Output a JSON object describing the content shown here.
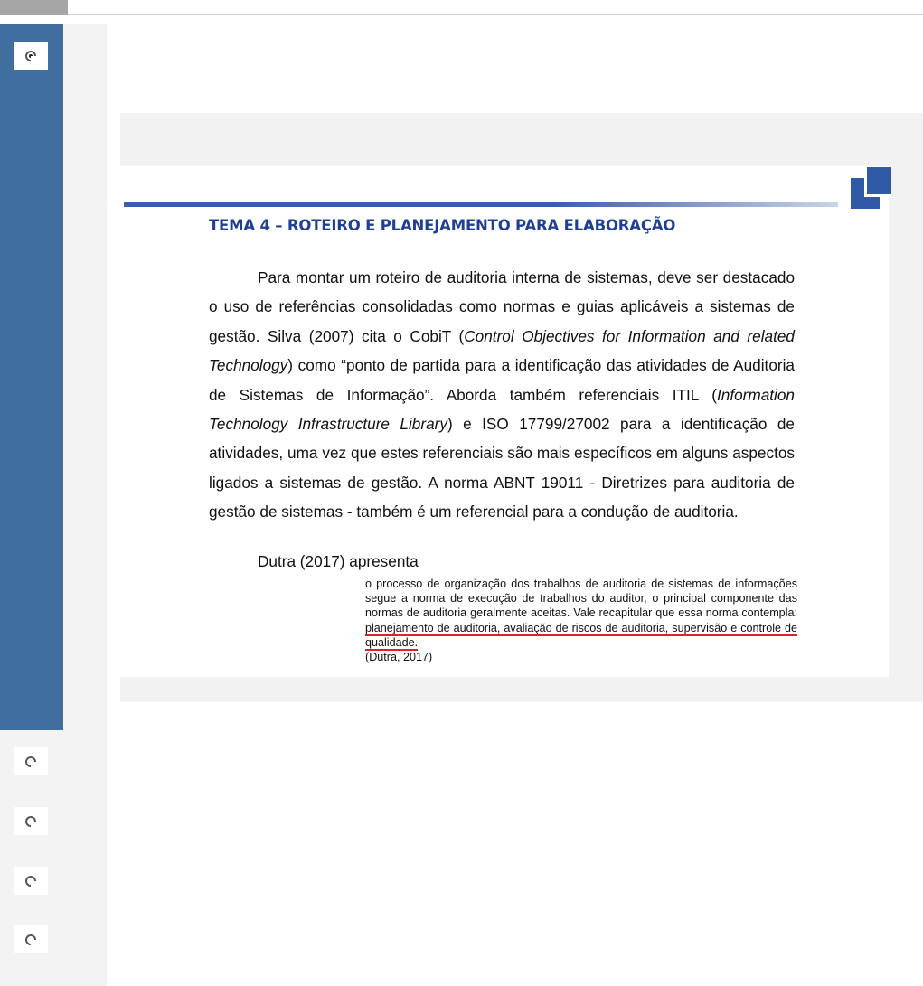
{
  "options": [
    {
      "selected": true
    },
    {
      "selected": false
    },
    {
      "selected": false
    },
    {
      "selected": false
    },
    {
      "selected": false
    }
  ],
  "slide": {
    "title": "TEMA 4 – ROTEIRO E PLANEJAMENTO PARA ELABORAÇÃO",
    "paragraph": {
      "t1": "Para montar um roteiro de auditoria interna de sistemas, deve ser destacado o uso de referências consolidadas como normas e guias aplicáveis a sistemas de gestão. Silva (2007) cita o CobiT (",
      "i1": "Control Objectives for Information and related Technology",
      "t2": ") como “ponto de partida para a identificação das atividades de Auditoria de Sistemas de Informação”. Aborda também referenciais ITIL (",
      "i2": "Information Technology Infrastructure Library",
      "t3": ") e ISO 17799/27002 para a identificação de atividades, uma vez que estes referenciais são mais específicos em alguns aspectos ligados a sistemas de gestão. A norma ABNT 19011 - Diretrizes para auditoria de gestão de sistemas - também é um referencial para a condução de auditoria."
    },
    "dutra_intro": "Dutra (2017) apresenta",
    "quote": {
      "text": "o processo de organização dos trabalhos de auditoria de sistemas de informações segue a norma de execução de trabalhos do auditor, o principal componente das normas de auditoria geralmente aceitas. Vale recapitular que essa norma contempla: ",
      "underlined": "planejamento de auditoria, avaliação de riscos de auditoria, supervisão e controle de qualidade.",
      "citation": "(Dutra, 2017)"
    }
  },
  "colors": {
    "sidebar": "#3f6e9f",
    "title": "#1f3f94",
    "underline": "#d9232d"
  }
}
